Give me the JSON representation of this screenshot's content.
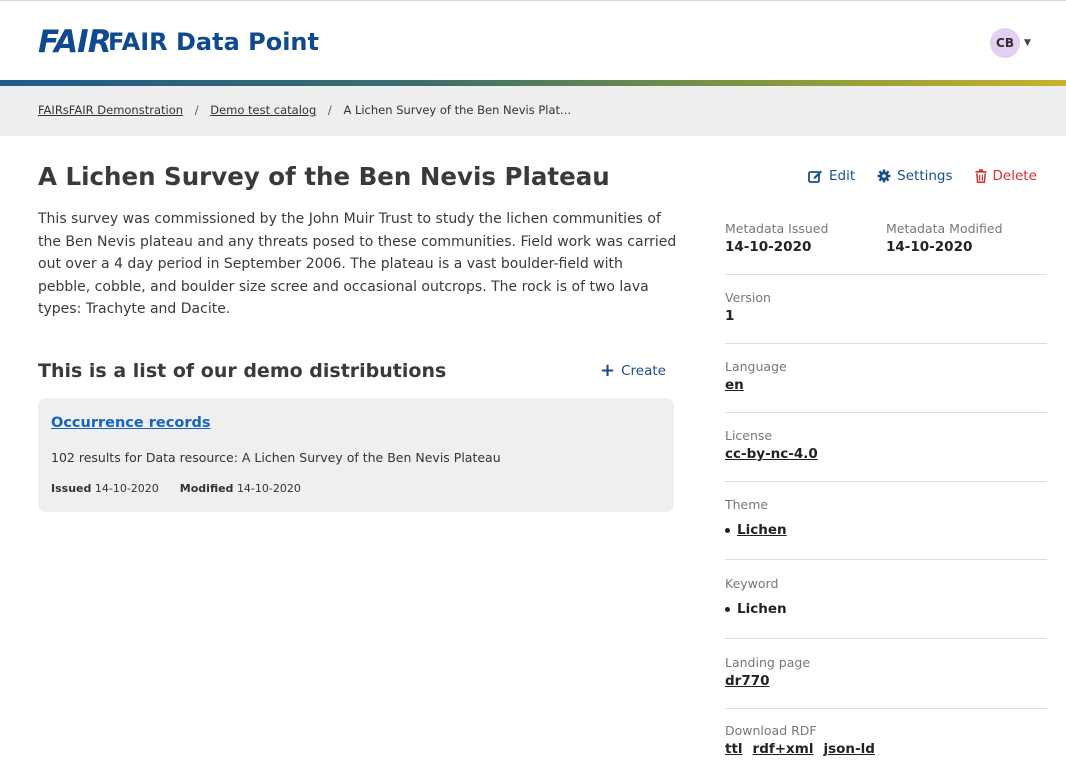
{
  "header": {
    "logo_text": "FAIR",
    "app_title": "FAIR Data Point",
    "user_initials": "CB"
  },
  "breadcrumb": {
    "items": [
      "FAIRsFAIR Demonstration",
      "Demo test catalog"
    ],
    "current": "A Lichen Survey of the Ben Nevis Plat...",
    "separator": "/"
  },
  "dataset": {
    "title": "A Lichen Survey of the Ben Nevis Plateau",
    "description": "This survey was commissioned by the John Muir Trust to study the lichen communities of the Ben Nevis plateau and any threats posed to these communities. Field work was carried out over a 4 day period in September 2006. The plateau is a vast boulder-field with pebble, cobble, and boulder size scree and occasional outcrops. The rock is of two lava types: Trachyte and Dacite."
  },
  "actions": {
    "edit": "Edit",
    "settings": "Settings",
    "delete": "Delete"
  },
  "distributions": {
    "section_title": "This is a list of our demo distributions",
    "create_label": "Create",
    "items": [
      {
        "title": "Occurrence records",
        "description": "102 results for Data resource: A Lichen Survey of the Ben Nevis Plateau",
        "issued_label": "Issued",
        "issued": "14-10-2020",
        "modified_label": "Modified",
        "modified": "14-10-2020"
      }
    ]
  },
  "metadata": {
    "issued_label": "Metadata Issued",
    "issued": "14-10-2020",
    "modified_label": "Metadata Modified",
    "modified": "14-10-2020",
    "version_label": "Version",
    "version": "1",
    "language_label": "Language",
    "language": "en",
    "license_label": "License",
    "license": "cc-by-nc-4.0",
    "theme_label": "Theme",
    "themes": [
      "Lichen"
    ],
    "keyword_label": "Keyword",
    "keywords": [
      "Lichen"
    ],
    "landing_page_label": "Landing page",
    "landing_page": "dr770",
    "download_label": "Download RDF",
    "download_formats": [
      "ttl",
      "rdf+xml",
      "json-ld"
    ]
  },
  "colors": {
    "brand_blue": "#0d4a8f",
    "link_blue": "#1565c0",
    "delete_red": "#d32f2f",
    "avatar_bg": "#e2cff2"
  }
}
